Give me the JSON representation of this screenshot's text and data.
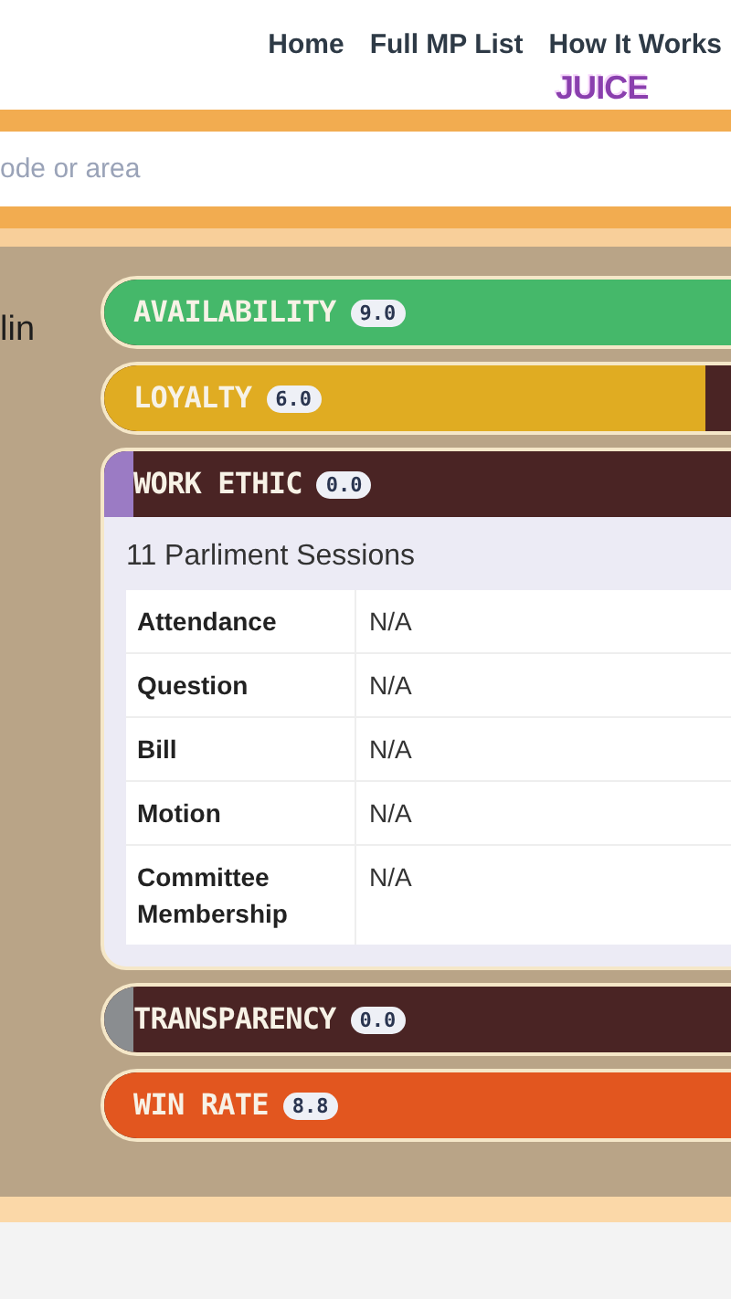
{
  "nav": {
    "links": [
      {
        "label": "Home"
      },
      {
        "label": "Full MP List"
      },
      {
        "label": "How It Works"
      }
    ],
    "logo": "JUICE"
  },
  "search": {
    "placeholder": "ode or area"
  },
  "mp_name": "lin",
  "categories": [
    {
      "label": "AVAILABILITY",
      "score": "9.0",
      "level": 0.9,
      "color": "#45b86a",
      "expanded": false
    },
    {
      "label": "LOYALTY",
      "score": "6.0",
      "level": 0.6,
      "color": "#e0ac22",
      "expanded": false
    },
    {
      "label": "WORK ETHIC",
      "score": "0.0",
      "level": 0,
      "color": "#9b7bc4",
      "expanded": true,
      "details": {
        "title": "11 Parliment Sessions",
        "rows": [
          {
            "label": "Attendance",
            "value": "N/A"
          },
          {
            "label": "Question",
            "value": "N/A"
          },
          {
            "label": "Bill",
            "value": "N/A"
          },
          {
            "label": "Motion",
            "value": "N/A"
          },
          {
            "label": "Committee Membership",
            "value": "N/A"
          }
        ]
      }
    },
    {
      "label": "TRANSPARENCY",
      "score": "0.0",
      "level": 0,
      "color": "#8a8d90",
      "expanded": false
    },
    {
      "label": "WIN RATE",
      "score": "8.8",
      "level": 0.88,
      "color": "#e2561f",
      "expanded": false
    }
  ]
}
